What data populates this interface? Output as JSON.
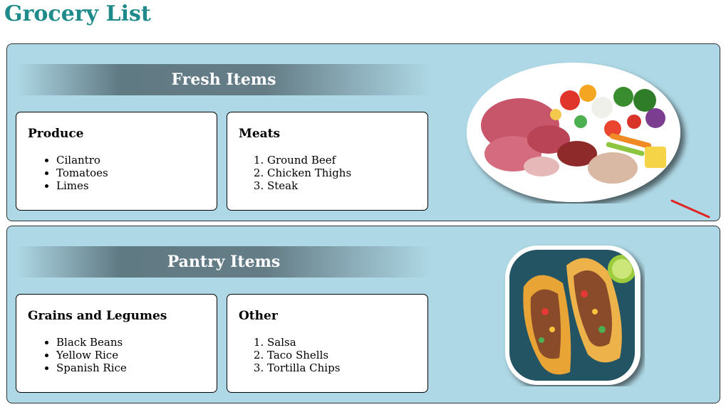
{
  "page": {
    "title": "Grocery List"
  },
  "sections": [
    {
      "banner": "Fresh Items",
      "left": {
        "title": "Produce",
        "items": [
          "Cilantro",
          "Tomatoes",
          "Limes"
        ]
      },
      "right": {
        "title": "Meats",
        "items": [
          "Ground Beef",
          "Chicken Thighs",
          "Steak"
        ]
      },
      "image": {
        "name": "fresh-food-platter-image"
      }
    },
    {
      "banner": "Pantry Items",
      "left": {
        "title": "Grains and Legumes",
        "items": [
          "Black Beans",
          "Yellow Rice",
          "Spanish Rice"
        ]
      },
      "right": {
        "title": "Other",
        "items": [
          "Salsa",
          "Taco Shells",
          "Tortilla Chips"
        ]
      },
      "image": {
        "name": "tacos-image"
      }
    }
  ],
  "colors": {
    "title": "#1f8a8a",
    "section_bg": "#aed8e5",
    "banner_mid": "#607a84"
  }
}
